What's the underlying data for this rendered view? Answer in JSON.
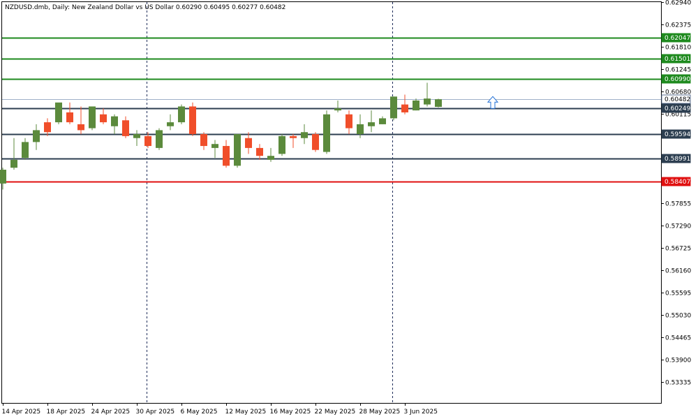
{
  "window": {
    "title": "NZDUSD.dmb, Daily:  New Zealand Dollar vs US Dollar  0.60290 0.60495 0.60277 0.60482"
  },
  "colors": {
    "bull": "#5b8a3c",
    "bear": "#f04e2a",
    "grid_frame": "#000000",
    "separator": "#1f2d5a",
    "resistance": "#1e8a1e",
    "support": "#2c3e50",
    "stop": "#e01010",
    "current_price": "#9eb0c8",
    "arrow": "#1f6fd6"
  },
  "chart_data": {
    "type": "candlestick",
    "title": "NZDUSD.dmb, Daily:  New Zealand Dollar vs US Dollar  0.60290 0.60495 0.60277 0.60482",
    "symbol": "NZDUSD.dmb",
    "timeframe": "Daily",
    "ylim": [
      0.528,
      0.6294
    ],
    "y_ticks": [
      "0.62940",
      "0.62375",
      "0.61810",
      "0.61245",
      "0.60680",
      "0.60115",
      "0.59550",
      "0.58985",
      "0.58420",
      "0.57855",
      "0.57290",
      "0.56725",
      "0.56160",
      "0.55595",
      "0.55030",
      "0.54465",
      "0.53900",
      "0.53335"
    ],
    "x_ticks": [
      "14 Apr 2025",
      "18 Apr 2025",
      "24 Apr 2025",
      "30 Apr 2025",
      "6 May 2025",
      "12 May 2025",
      "16 May 2025",
      "22 May 2025",
      "28 May 2025",
      "3 Jun 2025"
    ],
    "candles": [
      {
        "o": 0.5835,
        "h": 0.5875,
        "l": 0.582,
        "c": 0.587
      },
      {
        "o": 0.5875,
        "h": 0.595,
        "l": 0.587,
        "c": 0.5895
      },
      {
        "o": 0.59,
        "h": 0.595,
        "l": 0.5895,
        "c": 0.594
      },
      {
        "o": 0.594,
        "h": 0.5985,
        "l": 0.592,
        "c": 0.597
      },
      {
        "o": 0.599,
        "h": 0.6,
        "l": 0.5955,
        "c": 0.5965
      },
      {
        "o": 0.599,
        "h": 0.603,
        "l": 0.5985,
        "c": 0.604
      },
      {
        "o": 0.6015,
        "h": 0.604,
        "l": 0.5985,
        "c": 0.599
      },
      {
        "o": 0.5985,
        "h": 0.603,
        "l": 0.596,
        "c": 0.597
      },
      {
        "o": 0.5975,
        "h": 0.603,
        "l": 0.597,
        "c": 0.603
      },
      {
        "o": 0.601,
        "h": 0.6025,
        "l": 0.5985,
        "c": 0.599
      },
      {
        "o": 0.598,
        "h": 0.601,
        "l": 0.596,
        "c": 0.6005
      },
      {
        "o": 0.5995,
        "h": 0.6005,
        "l": 0.595,
        "c": 0.5955
      },
      {
        "o": 0.595,
        "h": 0.597,
        "l": 0.593,
        "c": 0.596
      },
      {
        "o": 0.5955,
        "h": 0.5965,
        "l": 0.5925,
        "c": 0.593
      },
      {
        "o": 0.5925,
        "h": 0.5975,
        "l": 0.592,
        "c": 0.597
      },
      {
        "o": 0.598,
        "h": 0.601,
        "l": 0.597,
        "c": 0.599
      },
      {
        "o": 0.599,
        "h": 0.6035,
        "l": 0.5985,
        "c": 0.603
      },
      {
        "o": 0.603,
        "h": 0.604,
        "l": 0.5955,
        "c": 0.596
      },
      {
        "o": 0.596,
        "h": 0.5965,
        "l": 0.592,
        "c": 0.593
      },
      {
        "o": 0.5925,
        "h": 0.5945,
        "l": 0.59,
        "c": 0.5935
      },
      {
        "o": 0.593,
        "h": 0.5945,
        "l": 0.5875,
        "c": 0.588
      },
      {
        "o": 0.588,
        "h": 0.596,
        "l": 0.5875,
        "c": 0.596
      },
      {
        "o": 0.595,
        "h": 0.5965,
        "l": 0.591,
        "c": 0.5925
      },
      {
        "o": 0.5925,
        "h": 0.5935,
        "l": 0.5895,
        "c": 0.5905
      },
      {
        "o": 0.5895,
        "h": 0.5925,
        "l": 0.589,
        "c": 0.5905
      },
      {
        "o": 0.591,
        "h": 0.596,
        "l": 0.5905,
        "c": 0.5955
      },
      {
        "o": 0.5955,
        "h": 0.596,
        "l": 0.5925,
        "c": 0.595
      },
      {
        "o": 0.595,
        "h": 0.5985,
        "l": 0.5935,
        "c": 0.5965
      },
      {
        "o": 0.596,
        "h": 0.5965,
        "l": 0.5915,
        "c": 0.592
      },
      {
        "o": 0.5915,
        "h": 0.602,
        "l": 0.591,
        "c": 0.601
      },
      {
        "o": 0.602,
        "h": 0.6045,
        "l": 0.6015,
        "c": 0.6025
      },
      {
        "o": 0.601,
        "h": 0.602,
        "l": 0.596,
        "c": 0.5975
      },
      {
        "o": 0.596,
        "h": 0.601,
        "l": 0.595,
        "c": 0.5985
      },
      {
        "o": 0.598,
        "h": 0.602,
        "l": 0.5965,
        "c": 0.599
      },
      {
        "o": 0.5985,
        "h": 0.6005,
        "l": 0.5985,
        "c": 0.6
      },
      {
        "o": 0.6,
        "h": 0.6055,
        "l": 0.5995,
        "c": 0.6055
      },
      {
        "o": 0.6035,
        "h": 0.606,
        "l": 0.601,
        "c": 0.6015
      },
      {
        "o": 0.602,
        "h": 0.605,
        "l": 0.602,
        "c": 0.6045
      },
      {
        "o": 0.6035,
        "h": 0.609,
        "l": 0.603,
        "c": 0.605
      },
      {
        "o": 0.6029,
        "h": 0.60495,
        "l": 0.60277,
        "c": 0.60482
      }
    ],
    "levels": [
      {
        "name": "resistance-3",
        "label": "0.62047",
        "value": 0.62047,
        "color": "#1e8a1e",
        "role": "resistance"
      },
      {
        "name": "resistance-2",
        "label": "0.61501",
        "value": 0.61501,
        "color": "#1e8a1e",
        "role": "resistance"
      },
      {
        "name": "resistance-1",
        "label": "0.60990",
        "value": 0.6099,
        "color": "#1e8a1e",
        "role": "resistance"
      },
      {
        "name": "current-price",
        "label": "0.60482",
        "value": 0.60482,
        "color": "#ffffff",
        "role": "bid"
      },
      {
        "name": "support-1",
        "label": "0.60249",
        "value": 0.60249,
        "color": "#2c3e50",
        "role": "support"
      },
      {
        "name": "support-2",
        "label": "0.59594",
        "value": 0.59594,
        "color": "#2c3e50",
        "role": "support"
      },
      {
        "name": "support-3",
        "label": "0.58991",
        "value": 0.58991,
        "color": "#2c3e50",
        "role": "support"
      },
      {
        "name": "stop-level",
        "label": "0.58407",
        "value": 0.58407,
        "color": "#e01010",
        "role": "stop"
      }
    ],
    "period_separators": [
      "30 Apr 2025",
      "3 Jun 2025"
    ],
    "arrow": {
      "direction": "up",
      "value": 0.6041
    },
    "grid": false
  }
}
